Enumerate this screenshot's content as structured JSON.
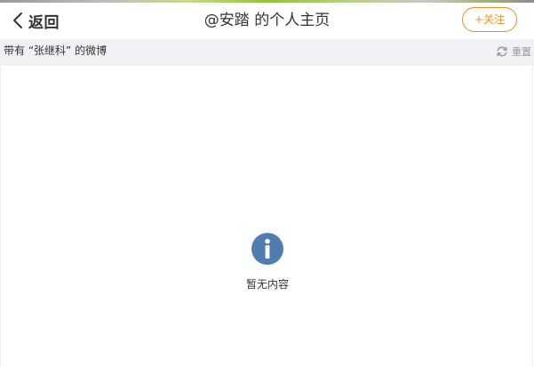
{
  "header": {
    "back_label": "返回",
    "title": "@安踏 的个人主页",
    "follow_label": "+关注"
  },
  "filter_bar": {
    "filter_text": "带有 “张继科” 的微博",
    "reset_label": "重置"
  },
  "empty_state": {
    "message": "暂无内容"
  },
  "colors": {
    "accent_orange": "#f08c1e",
    "info_blue": "#507daf",
    "filter_bg": "#f0f1f4",
    "muted_text": "#999999"
  },
  "icons": {
    "back": "chevron-left-icon",
    "reset": "refresh-icon",
    "empty": "info-icon"
  }
}
